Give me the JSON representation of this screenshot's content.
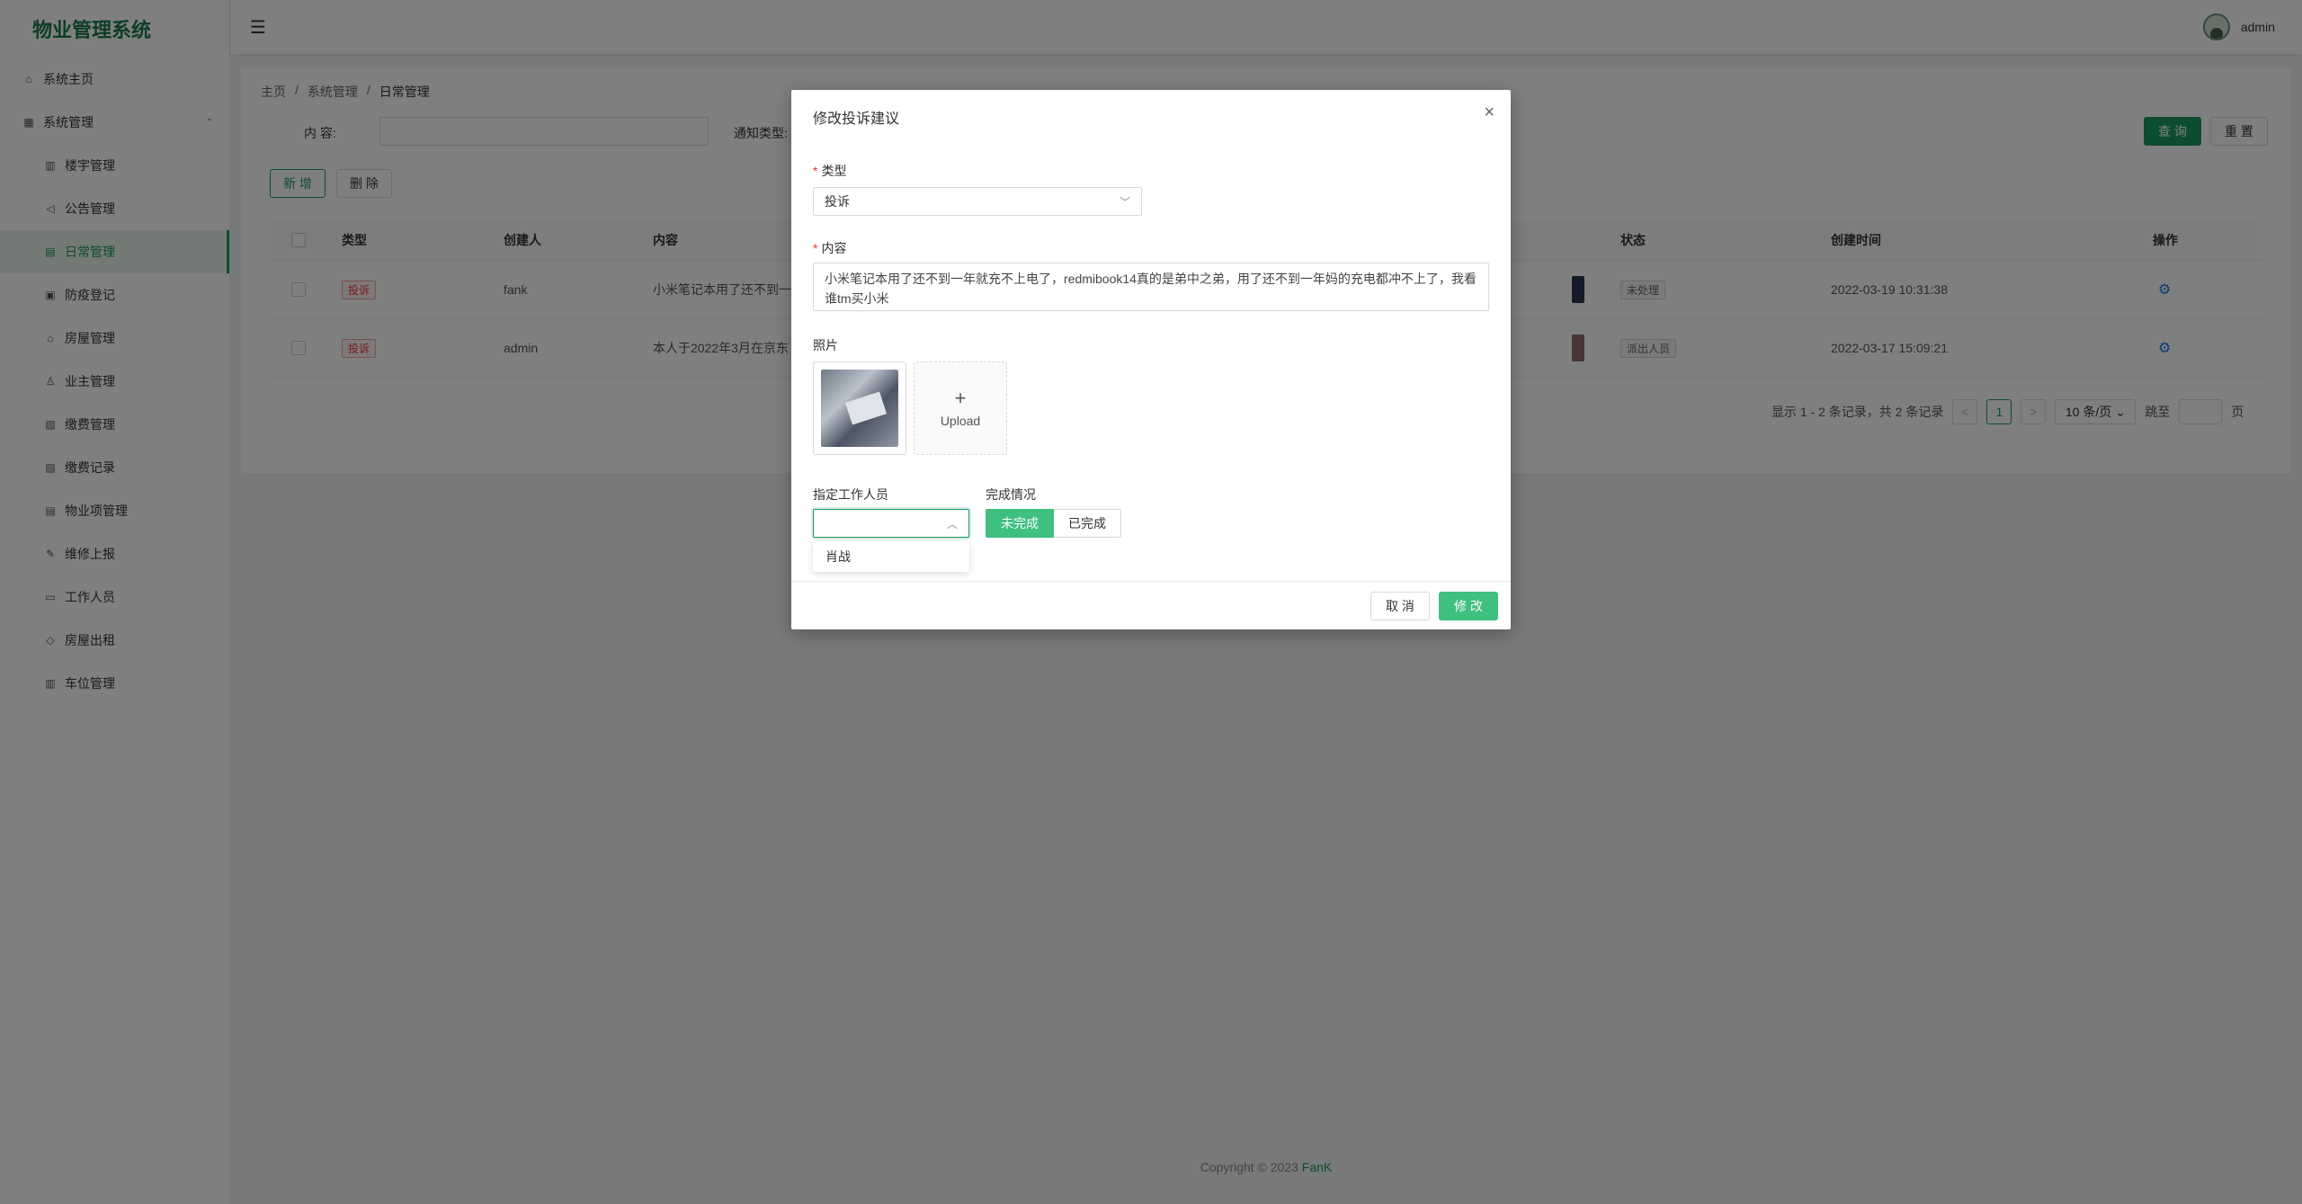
{
  "app": {
    "title": "物业管理系统"
  },
  "sidebar": {
    "items": [
      {
        "label": "系统主页",
        "icon": "home-icon",
        "glyph": "⌂"
      },
      {
        "label": "系统管理",
        "icon": "grid-icon",
        "glyph": "▦"
      },
      {
        "label": "楼宇管理",
        "icon": "building-icon",
        "glyph": "▥"
      },
      {
        "label": "公告管理",
        "icon": "megaphone-icon",
        "glyph": "◁"
      },
      {
        "label": "日常管理",
        "icon": "calendar-icon",
        "glyph": "▤"
      },
      {
        "label": "防疫登记",
        "icon": "shield-icon",
        "glyph": "▣"
      },
      {
        "label": "房屋管理",
        "icon": "house-icon",
        "glyph": "⌂"
      },
      {
        "label": "业主管理",
        "icon": "user-icon",
        "glyph": "♙"
      },
      {
        "label": "缴费管理",
        "icon": "invoice-icon",
        "glyph": "▧"
      },
      {
        "label": "缴费记录",
        "icon": "record-icon",
        "glyph": "▨"
      },
      {
        "label": "物业项管理",
        "icon": "list-icon",
        "glyph": "▤"
      },
      {
        "label": "维修上报",
        "icon": "wrench-icon",
        "glyph": "✎"
      },
      {
        "label": "工作人员",
        "icon": "id-card-icon",
        "glyph": "▭"
      },
      {
        "label": "房屋出租",
        "icon": "tag-icon",
        "glyph": "◇"
      },
      {
        "label": "车位管理",
        "icon": "parking-icon",
        "glyph": "▥"
      }
    ]
  },
  "header": {
    "username": "admin"
  },
  "breadcrumb": {
    "home": "主页",
    "sep": "/",
    "parent": "系统管理",
    "current": "日常管理"
  },
  "search": {
    "content_label": "内 容:",
    "type_label": "通知类型:",
    "query": "查 询",
    "reset": "重 置"
  },
  "toolbar": {
    "add": "新 增",
    "delete": "删 除"
  },
  "table": {
    "headers": {
      "type": "类型",
      "creator": "创建人",
      "content": "内容",
      "status": "状态",
      "created": "创建时间",
      "action": "操作"
    },
    "rows": [
      {
        "type": "投诉",
        "creator": "fank",
        "content": "小米笔记本用了还不到一",
        "status": "未处理",
        "created": "2022-03-19 10:31:38"
      },
      {
        "type": "投诉",
        "creator": "admin",
        "content": "本人于2022年3月在京东",
        "status": "派出人员",
        "created": "2022-03-17 15:09:21"
      }
    ]
  },
  "pagination": {
    "summary": "显示 1 - 2 条记录，共 2 条记录",
    "prev": "<",
    "page": "1",
    "next": ">",
    "size": "10 条/页",
    "jump": "跳至",
    "unit": "页"
  },
  "dialog": {
    "title": "修改投诉建议",
    "close": "×",
    "type_label": "类型",
    "type_value": "投诉",
    "content_label": "内容",
    "content_value": "小米笔记本用了还不到一年就充不上电了，redmibook14真的是弟中之弟，用了还不到一年妈的充电都冲不上了，我看谁tm买小米",
    "photo_label": "照片",
    "upload_plus": "+",
    "upload_text": "Upload",
    "staff_label": "指定工作人员",
    "staff_option": "肖战",
    "done_label": "完成情况",
    "seg_on": "未完成",
    "seg_off": "已完成",
    "cancel": "取 消",
    "submit": "修 改"
  },
  "footer": {
    "copyright": "Copyright © 2023 ",
    "author": "FanK"
  },
  "colors": {
    "accent": "#1a9a5c",
    "danger": "#e33333",
    "link": "#1a73e8"
  }
}
